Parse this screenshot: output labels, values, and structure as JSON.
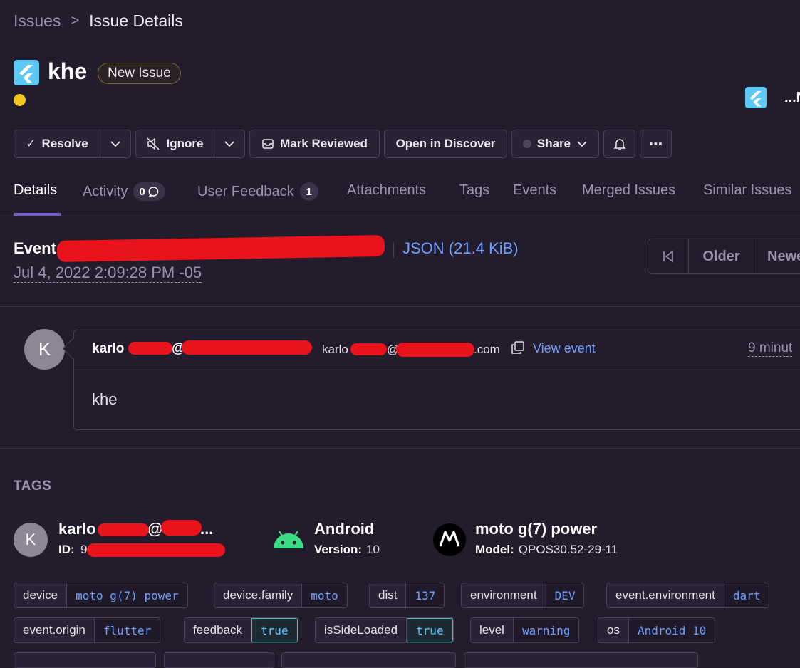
{
  "breadcrumb": {
    "parent": "Issues",
    "sep": ">",
    "current": "Issue Details"
  },
  "issue": {
    "title": "khe",
    "badge": "New Issue",
    "right_label": "...N"
  },
  "toolbar": {
    "resolve": "Resolve",
    "ignore": "Ignore",
    "mark_reviewed": "Mark Reviewed",
    "open_discover": "Open in Discover",
    "share": "Share",
    "more": "⋯"
  },
  "tabs": [
    {
      "label": "Details",
      "active": true
    },
    {
      "label": "Activity",
      "count": "0"
    },
    {
      "label": "User Feedback",
      "count": "1"
    },
    {
      "label": "Attachments"
    },
    {
      "label": "Tags"
    },
    {
      "label": "Events"
    },
    {
      "label": "Merged Issues"
    },
    {
      "label": "Similar Issues"
    }
  ],
  "event": {
    "label": "Event",
    "json_link": "JSON (21.4 KiB)",
    "date": "Jul 4, 2022 2:09:28 PM -05",
    "nav": {
      "oldest_icon": "first-page-icon",
      "older": "Older",
      "newer": "Newe"
    }
  },
  "feedback": {
    "avatar": "K",
    "name_prefix": "karlo",
    "at": "@",
    "email_prefix": "karlo",
    "email_at": "@",
    "email_suffix": ".com",
    "view_event": "View event",
    "time": "9 minut",
    "comment": "khe"
  },
  "tags_section": {
    "heading": "TAGS",
    "user": {
      "avatar": "K",
      "name_prefix": "karlo",
      "name_mid": "@",
      "name_suffix": "...",
      "id_label": "ID:",
      "id_value_prefix": "9"
    },
    "os": {
      "name": "Android",
      "version_label": "Version:",
      "version": "10"
    },
    "device": {
      "name": "moto g(7) power",
      "model_label": "Model:",
      "model": "QPOS30.52-29-11"
    },
    "tags": [
      {
        "key": "device",
        "value": "moto g(7) power"
      },
      {
        "key": "device.family",
        "value": "moto"
      },
      {
        "key": "dist",
        "value": "137"
      },
      {
        "key": "environment",
        "value": "DEV"
      },
      {
        "key": "event.environment",
        "value": "dart"
      },
      {
        "key": "event.origin",
        "value": "flutter"
      },
      {
        "key": "feedback",
        "value": "true"
      },
      {
        "key": "isSideLoaded",
        "value": "true"
      },
      {
        "key": "level",
        "value": "warning"
      },
      {
        "key": "os",
        "value": "Android 10"
      }
    ]
  },
  "colors": {
    "accent": "#6c5fc7",
    "link": "#6e9fff",
    "warning_dot": "#f5c51f",
    "redaction": "#e8131b"
  }
}
